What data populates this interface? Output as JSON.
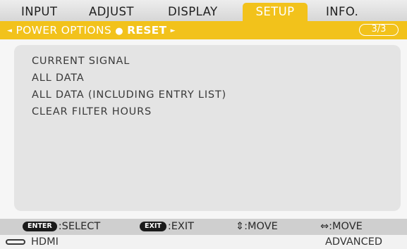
{
  "tabs": [
    {
      "label": "INPUT",
      "active": false
    },
    {
      "label": "ADJUST",
      "active": false
    },
    {
      "label": "DISPLAY",
      "active": false
    },
    {
      "label": "SETUP",
      "active": true
    },
    {
      "label": "INFO.",
      "active": false
    }
  ],
  "breadcrumb": {
    "left_arrow": "◄",
    "parent": "POWER OPTIONS",
    "separator": "●",
    "current": "RESET",
    "right_arrow": "►",
    "page_indicator": "3/3"
  },
  "menu": {
    "items": [
      "CURRENT SIGNAL",
      "ALL DATA",
      "ALL DATA (INCLUDING ENTRY LIST)",
      "CLEAR FILTER HOURS"
    ]
  },
  "keyhints": [
    {
      "key": "ENTER",
      "label": ":SELECT"
    },
    {
      "key": "EXIT",
      "label": ":EXIT"
    },
    {
      "key": "⇕",
      "label": ":MOVE"
    },
    {
      "key": "⇔",
      "label": ":MOVE"
    }
  ],
  "status": {
    "input_icon": "hdmi-icon",
    "input_name": "HDMI",
    "mode": "ADVANCED"
  },
  "colors": {
    "accent": "#f2c21b",
    "crumb_current": "#ffffff",
    "panel_bg": "#e4e4e4",
    "key_bg": "#1a1a1a"
  }
}
